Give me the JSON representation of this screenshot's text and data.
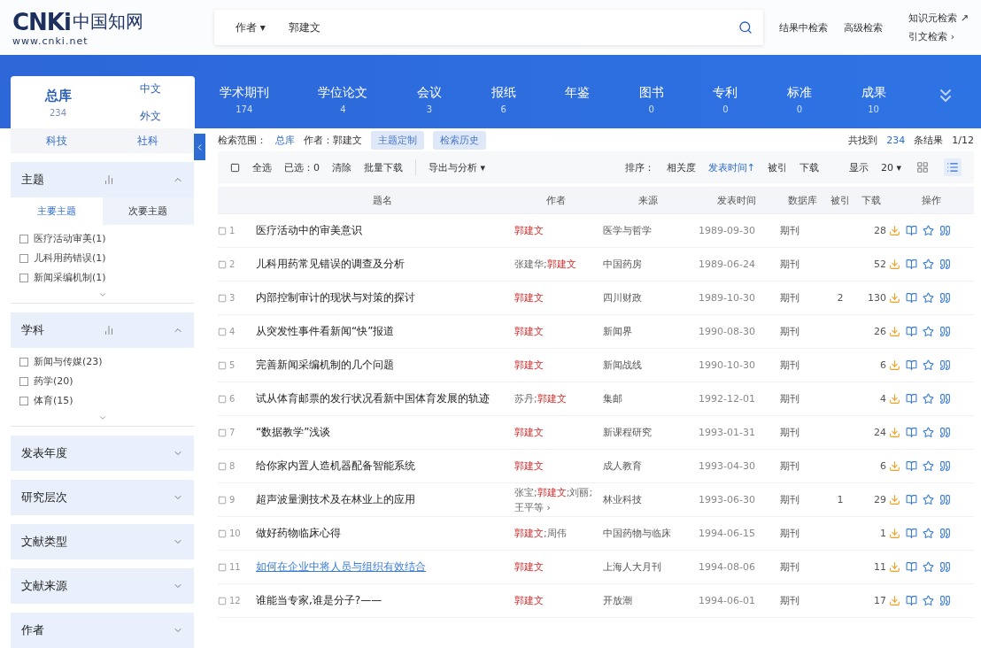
{
  "header": {
    "logo": {
      "mark": "CNKi",
      "name": "中国知网",
      "url": "www.cnki.net"
    },
    "search": {
      "field": "作者",
      "caret": "▾",
      "value": "郭建文"
    },
    "links": [
      "结果中检索",
      "高级检索"
    ],
    "side_links": [
      {
        "label": "知识元检索",
        "arrow": "↗"
      },
      {
        "label": "引文检索",
        "arrow": "›"
      }
    ]
  },
  "nav": {
    "scope": {
      "title": "总库",
      "count": "234",
      "langs": [
        "中文",
        "外文"
      ]
    },
    "tabs": [
      {
        "label": "学术期刊",
        "count": "174"
      },
      {
        "label": "学位论文",
        "count": "4"
      },
      {
        "label": "会议",
        "count": "3"
      },
      {
        "label": "报纸",
        "count": "6"
      },
      {
        "label": "年鉴"
      },
      {
        "label": "图书",
        "count": "0"
      },
      {
        "label": "专利",
        "count": "0"
      },
      {
        "label": "标准",
        "count": "0"
      },
      {
        "label": "成果",
        "count": "10"
      }
    ]
  },
  "sidebar": {
    "top_tabs": [
      "科技",
      "社科"
    ],
    "sections": [
      {
        "title": "主题",
        "expanded": true,
        "subtabs": [
          {
            "label": "主要主题",
            "selected": true
          },
          {
            "label": "次要主题",
            "selected": false
          }
        ],
        "items": [
          {
            "label": "医疗活动审美(1)",
            "checked": false
          },
          {
            "label": "儿科用药错误(1)",
            "checked": false
          },
          {
            "label": "新闻采编机制(1)",
            "checked": false
          }
        ]
      },
      {
        "title": "学科",
        "expanded": true,
        "items": [
          {
            "label": "新闻与传媒(23)",
            "checked": false
          },
          {
            "label": "药学(20)",
            "checked": false
          },
          {
            "label": "体育(15)",
            "checked": false
          }
        ]
      },
      {
        "title": "发表年度",
        "expanded": false
      },
      {
        "title": "研究层次",
        "expanded": false
      },
      {
        "title": "文献类型",
        "expanded": false
      },
      {
        "title": "文献来源",
        "expanded": false
      },
      {
        "title": "作者",
        "expanded": false
      }
    ]
  },
  "results": {
    "scope_label": "检索范围：",
    "scope": "总库",
    "query": "作者：郭建文",
    "chips": [
      "主题定制",
      "检索历史"
    ],
    "found_prefix": "共找到",
    "found": "234",
    "found_suffix": "条结果",
    "page": "1/12",
    "actions": {
      "select_all": "全选",
      "selected": "已选：0",
      "clear": "清除",
      "batch": "批量下载",
      "export": "导出与分析 ▾"
    },
    "sort": {
      "label": "排序：",
      "options": [
        {
          "label": "相关度",
          "selected": false
        },
        {
          "label": "发表时间↑",
          "selected": true
        },
        {
          "label": "被引",
          "selected": false
        },
        {
          "label": "下载",
          "selected": false
        }
      ]
    },
    "page_size": {
      "label": "显示",
      "value": "20 ▾"
    },
    "columns": [
      "题名",
      "作者",
      "来源",
      "发表时间",
      "数据库",
      "被引",
      "下载",
      "操作"
    ],
    "rows": [
      {
        "num": "1",
        "title": "医疗活动中的审美意识",
        "authors": [
          {
            "name": "郭建文",
            "match": true
          }
        ],
        "source": "医学与哲学",
        "date": "1989-09-30",
        "db": "期刊",
        "downloads": "28",
        "link": false
      },
      {
        "num": "2",
        "title": "儿科用药常见错误的调查及分析",
        "authors": [
          {
            "name": "张建华;",
            "match": false
          },
          {
            "name": "郭建文",
            "match": true
          }
        ],
        "source": "中国药房",
        "date": "1989-06-24",
        "db": "期刊",
        "downloads": "52",
        "link": false
      },
      {
        "num": "3",
        "title": "内部控制审计的现状与对策的探讨",
        "authors": [
          {
            "name": "郭建文",
            "match": true
          }
        ],
        "source": "四川财政",
        "date": "1989-10-30",
        "db": "期刊",
        "cited": "2",
        "downloads": "130",
        "link": false
      },
      {
        "num": "4",
        "title": "从突发性事件看新闻“快”报道",
        "authors": [
          {
            "name": "郭建文",
            "match": true
          }
        ],
        "source": "新闻界",
        "date": "1990-08-30",
        "db": "期刊",
        "downloads": "26",
        "link": false
      },
      {
        "num": "5",
        "title": "完善新闻采编机制的几个问题",
        "authors": [
          {
            "name": "郭建文",
            "match": true
          }
        ],
        "source": "新闻战线",
        "date": "1990-10-30",
        "db": "期刊",
        "downloads": "6",
        "link": false
      },
      {
        "num": "6",
        "title": "试从体育邮票的发行状况看新中国体育发展的轨迹",
        "authors": [
          {
            "name": "苏丹;",
            "match": false
          },
          {
            "name": "郭建文",
            "match": true
          }
        ],
        "source": "集邮",
        "date": "1992-12-01",
        "db": "期刊",
        "downloads": "4",
        "link": false
      },
      {
        "num": "7",
        "title": "“数据教学”浅谈",
        "authors": [
          {
            "name": "郭建文",
            "match": true
          }
        ],
        "source": "新课程研究",
        "date": "1993-01-31",
        "db": "期刊",
        "downloads": "24",
        "link": false
      },
      {
        "num": "8",
        "title": "给你家内置人造机器配备智能系统",
        "authors": [
          {
            "name": "郭建文",
            "match": true
          }
        ],
        "source": "成人教育",
        "date": "1993-04-30",
        "db": "期刊",
        "downloads": "6",
        "link": false
      },
      {
        "num": "9",
        "title": "超声波量测技术及在林业上的应用",
        "authors": [
          {
            "name": "张宝;",
            "match": false
          },
          {
            "name": "郭建文",
            "match": true
          },
          {
            "name": ";刘丽;",
            "match": false
          },
          {
            "name": "王平等 ›",
            "match": false
          }
        ],
        "source": "林业科技",
        "date": "1993-06-30",
        "db": "期刊",
        "cited": "1",
        "downloads": "29",
        "link": false
      },
      {
        "num": "10",
        "title": "做好药物临床心得",
        "authors": [
          {
            "name": "郭建文",
            "match": true
          },
          {
            "name": ";周伟",
            "match": false
          }
        ],
        "source": "中国药物与临床",
        "date": "1994-06-15",
        "db": "期刊",
        "downloads": "1",
        "link": false
      },
      {
        "num": "11",
        "title": "如何在企业中将人员与组织有效结合",
        "authors": [
          {
            "name": "郭建文",
            "match": true
          }
        ],
        "source": "上海人大月刊",
        "date": "1994-08-06",
        "db": "期刊",
        "downloads": "11",
        "link": true
      },
      {
        "num": "12",
        "title": "谁能当专家,谁是分子?——",
        "authors": [
          {
            "name": "郭建文",
            "match": true
          }
        ],
        "source": "开放潮",
        "date": "1994-06-01",
        "db": "期刊",
        "downloads": "17",
        "link": false
      }
    ]
  }
}
